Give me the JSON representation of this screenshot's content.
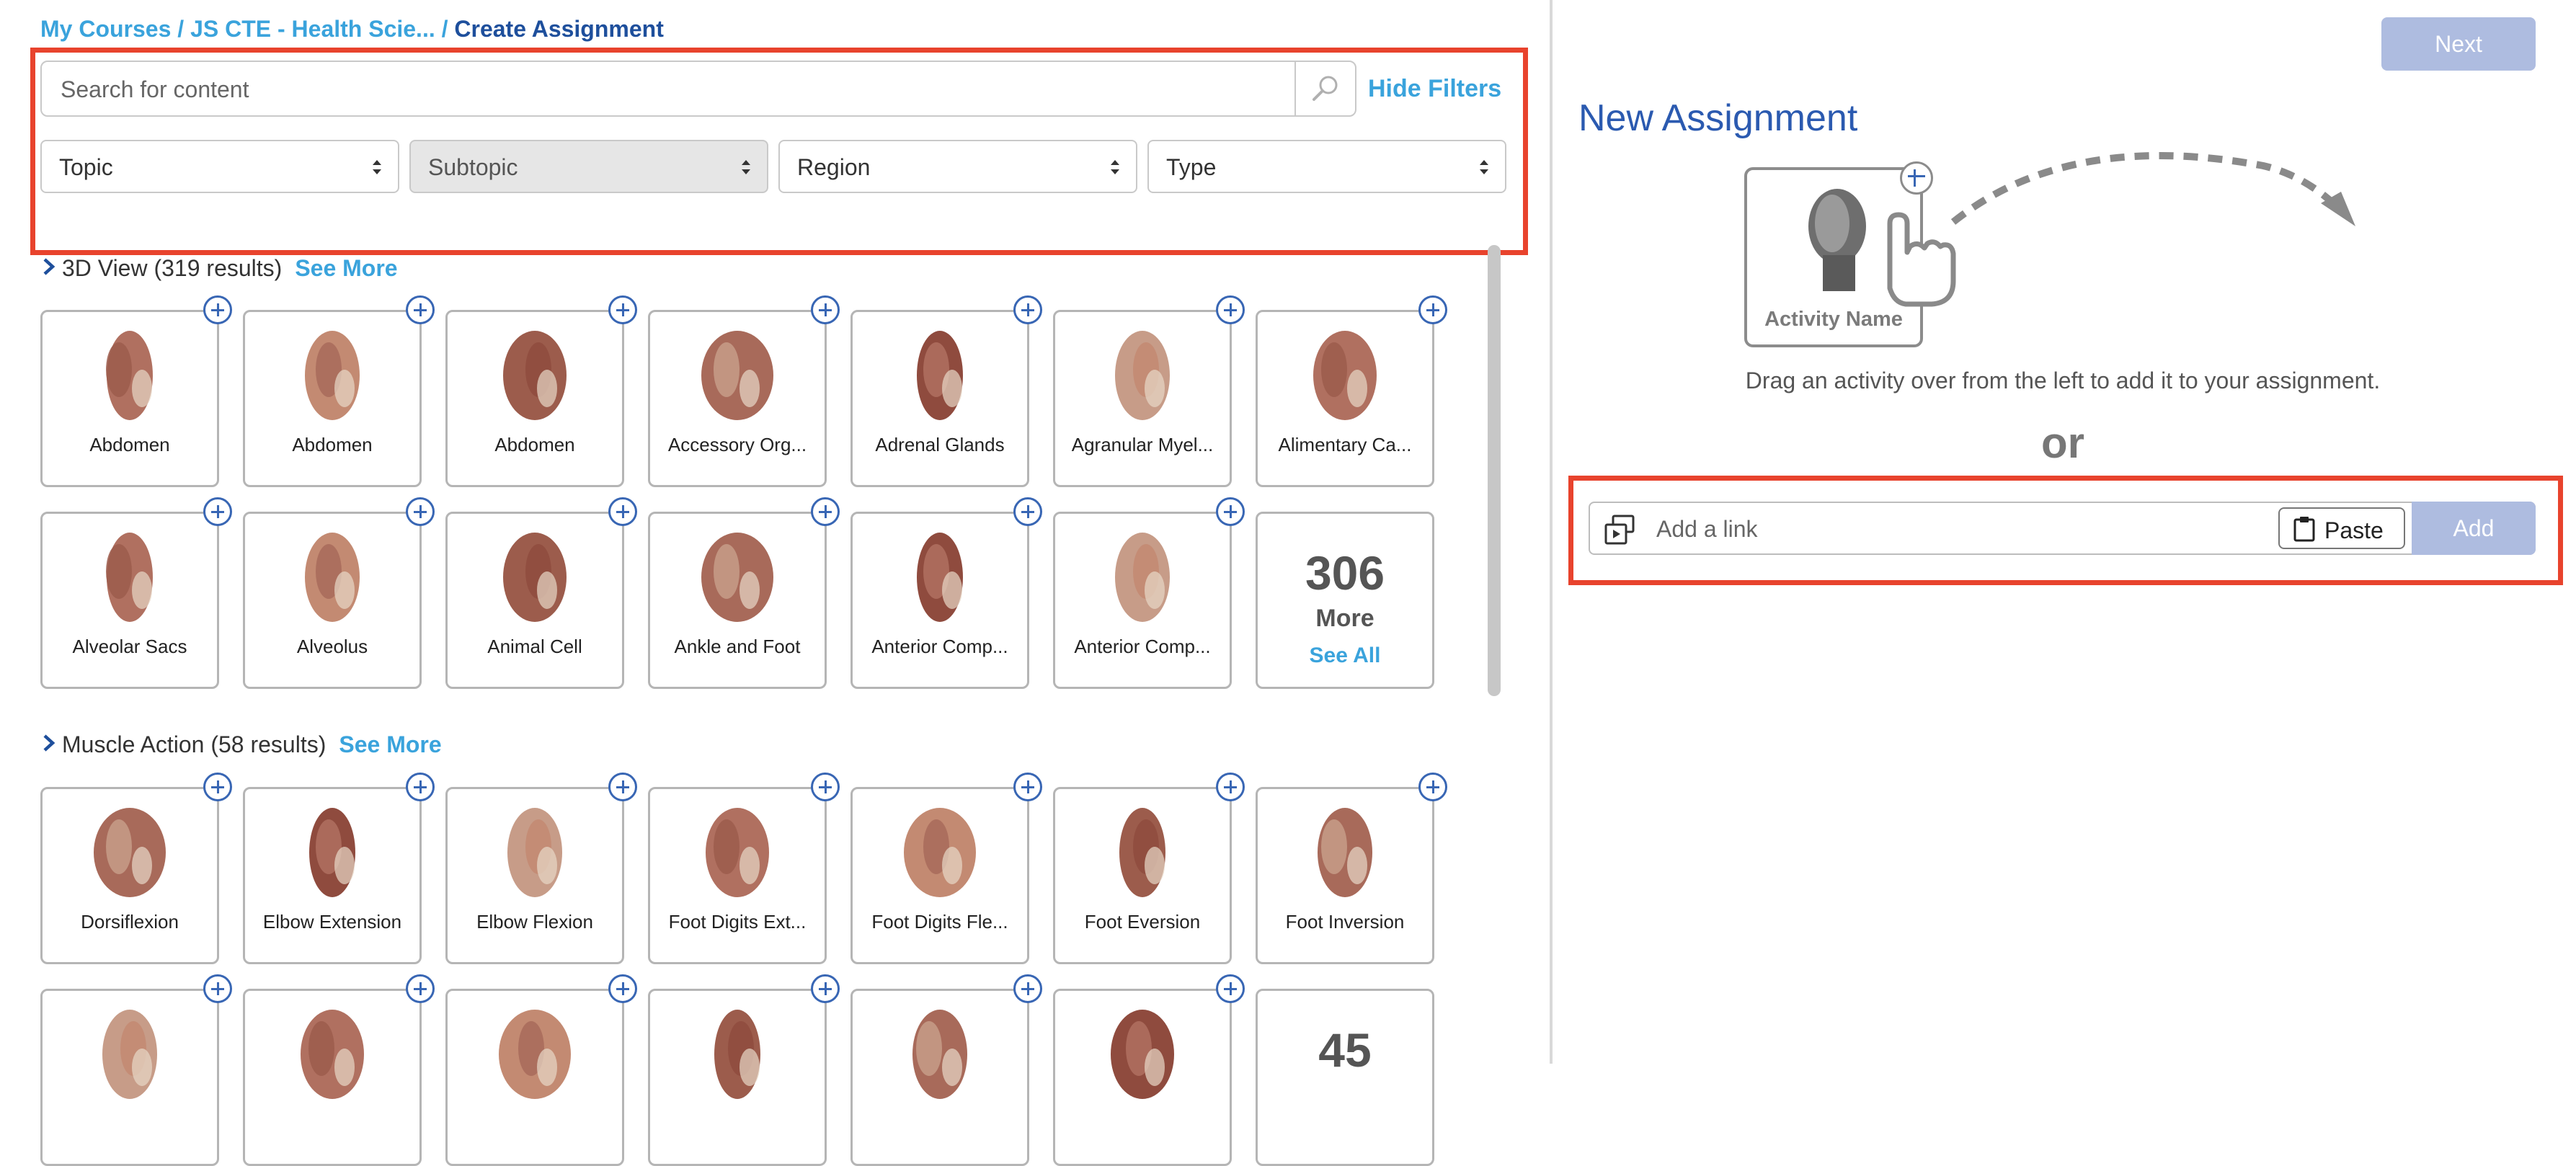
{
  "breadcrumb": {
    "my_courses": "My Courses",
    "sep1": " / ",
    "course": "JS CTE - Health Scie...",
    "sep2": " / ",
    "current": "Create Assignment"
  },
  "search": {
    "placeholder": "Search for content",
    "hide_filters": "Hide Filters",
    "icon": "search-icon"
  },
  "filters": [
    {
      "label": "Topic",
      "disabled": false
    },
    {
      "label": "Subtopic",
      "disabled": true
    },
    {
      "label": "Region",
      "disabled": false
    },
    {
      "label": "Type",
      "disabled": false
    }
  ],
  "sections": [
    {
      "title": "3D View",
      "count": "(319 results)",
      "see_more": "See More",
      "row1": [
        "Abdomen",
        "Abdomen",
        "Abdomen",
        "Accessory Org...",
        "Adrenal Glands",
        "Agranular Myel...",
        "Alimentary Ca..."
      ],
      "row2": [
        "Alveolar Sacs",
        "Alveolus",
        "Animal Cell",
        "Ankle and Foot",
        "Anterior Comp...",
        "Anterior Comp..."
      ],
      "more_count": "306",
      "more_label": "More",
      "see_all": "See All"
    },
    {
      "title": "Muscle Action",
      "count": "(58 results)",
      "see_more": "See More",
      "row1": [
        "Dorsiflexion",
        "Elbow Extension",
        "Elbow Flexion",
        "Foot Digits Ext...",
        "Foot Digits Fle...",
        "Foot Eversion",
        "Foot Inversion"
      ],
      "more_count": "45"
    }
  ],
  "right": {
    "next": "Next",
    "title": "New Assignment",
    "activity_name": "Activity Name",
    "hint": "Drag an activity over from the left to add it to your assignment.",
    "or": "or",
    "link_placeholder": "Add a link",
    "paste": "Paste",
    "add": "Add"
  },
  "colors": {
    "accent": "#3aa3dc",
    "title_blue": "#2b5ab0",
    "highlight": "#e8432d",
    "disabled_button": "#aebce0"
  }
}
